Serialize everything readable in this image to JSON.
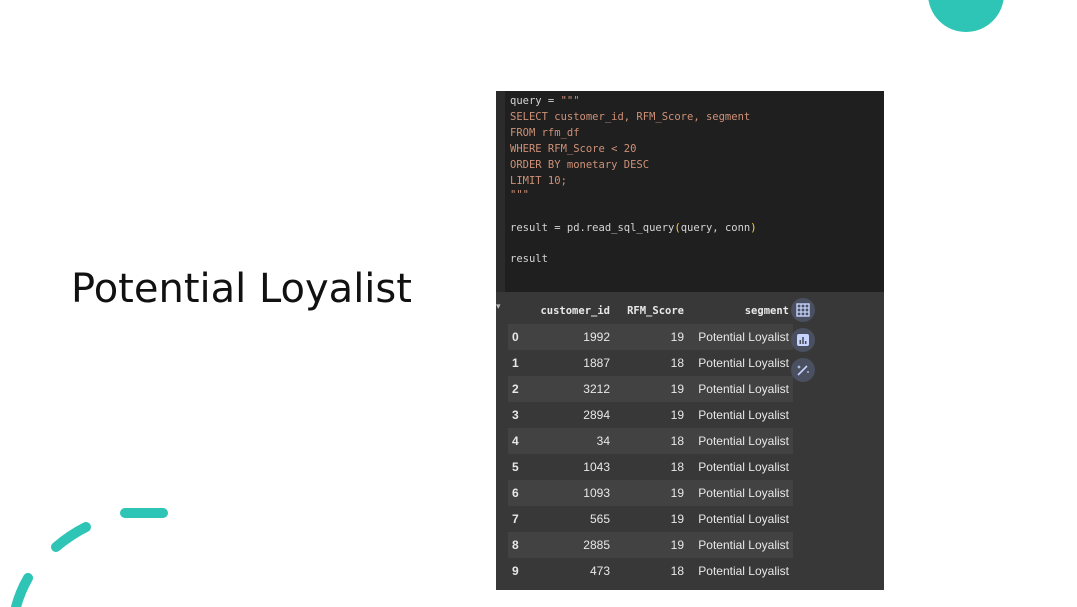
{
  "slide": {
    "title": "Potential Loyalist",
    "accent_color": "#2ec4b6"
  },
  "code_cell": {
    "lines": [
      {
        "text": "query = ",
        "str": "\"\"\""
      },
      {
        "text": "",
        "str": "SELECT customer_id, RFM_Score, segment"
      },
      {
        "text": "",
        "str": "FROM rfm_df"
      },
      {
        "text": "",
        "str": "WHERE RFM_Score < 20"
      },
      {
        "text": "",
        "str": "ORDER BY monetary DESC"
      },
      {
        "text": "",
        "str": "LIMIT 10;"
      },
      {
        "text": "",
        "str": "\"\"\""
      },
      {
        "text": "",
        "str": ""
      },
      {
        "text": "result = pd.read_sql_query",
        "paren_open": "(",
        "args": "query, conn",
        "paren_close": ")"
      },
      {
        "text": "",
        "str": ""
      },
      {
        "text": "result",
        "str": ""
      }
    ]
  },
  "output": {
    "columns": [
      "customer_id",
      "RFM_Score",
      "segment"
    ],
    "rows": [
      {
        "idx": "0",
        "customer_id": "1992",
        "rfm": "19",
        "segment": "Potential Loyalist"
      },
      {
        "idx": "1",
        "customer_id": "1887",
        "rfm": "18",
        "segment": "Potential Loyalist"
      },
      {
        "idx": "2",
        "customer_id": "3212",
        "rfm": "19",
        "segment": "Potential Loyalist"
      },
      {
        "idx": "3",
        "customer_id": "2894",
        "rfm": "19",
        "segment": "Potential Loyalist"
      },
      {
        "idx": "4",
        "customer_id": "34",
        "rfm": "18",
        "segment": "Potential Loyalist"
      },
      {
        "idx": "5",
        "customer_id": "1043",
        "rfm": "18",
        "segment": "Potential Loyalist"
      },
      {
        "idx": "6",
        "customer_id": "1093",
        "rfm": "19",
        "segment": "Potential Loyalist"
      },
      {
        "idx": "7",
        "customer_id": "565",
        "rfm": "19",
        "segment": "Potential Loyalist"
      },
      {
        "idx": "8",
        "customer_id": "2885",
        "rfm": "19",
        "segment": "Potential Loyalist"
      },
      {
        "idx": "9",
        "customer_id": "473",
        "rfm": "18",
        "segment": "Potential Loyalist"
      }
    ],
    "side_buttons": [
      {
        "name": "table-icon"
      },
      {
        "name": "chart-icon"
      },
      {
        "name": "magic-wand-icon"
      }
    ]
  }
}
